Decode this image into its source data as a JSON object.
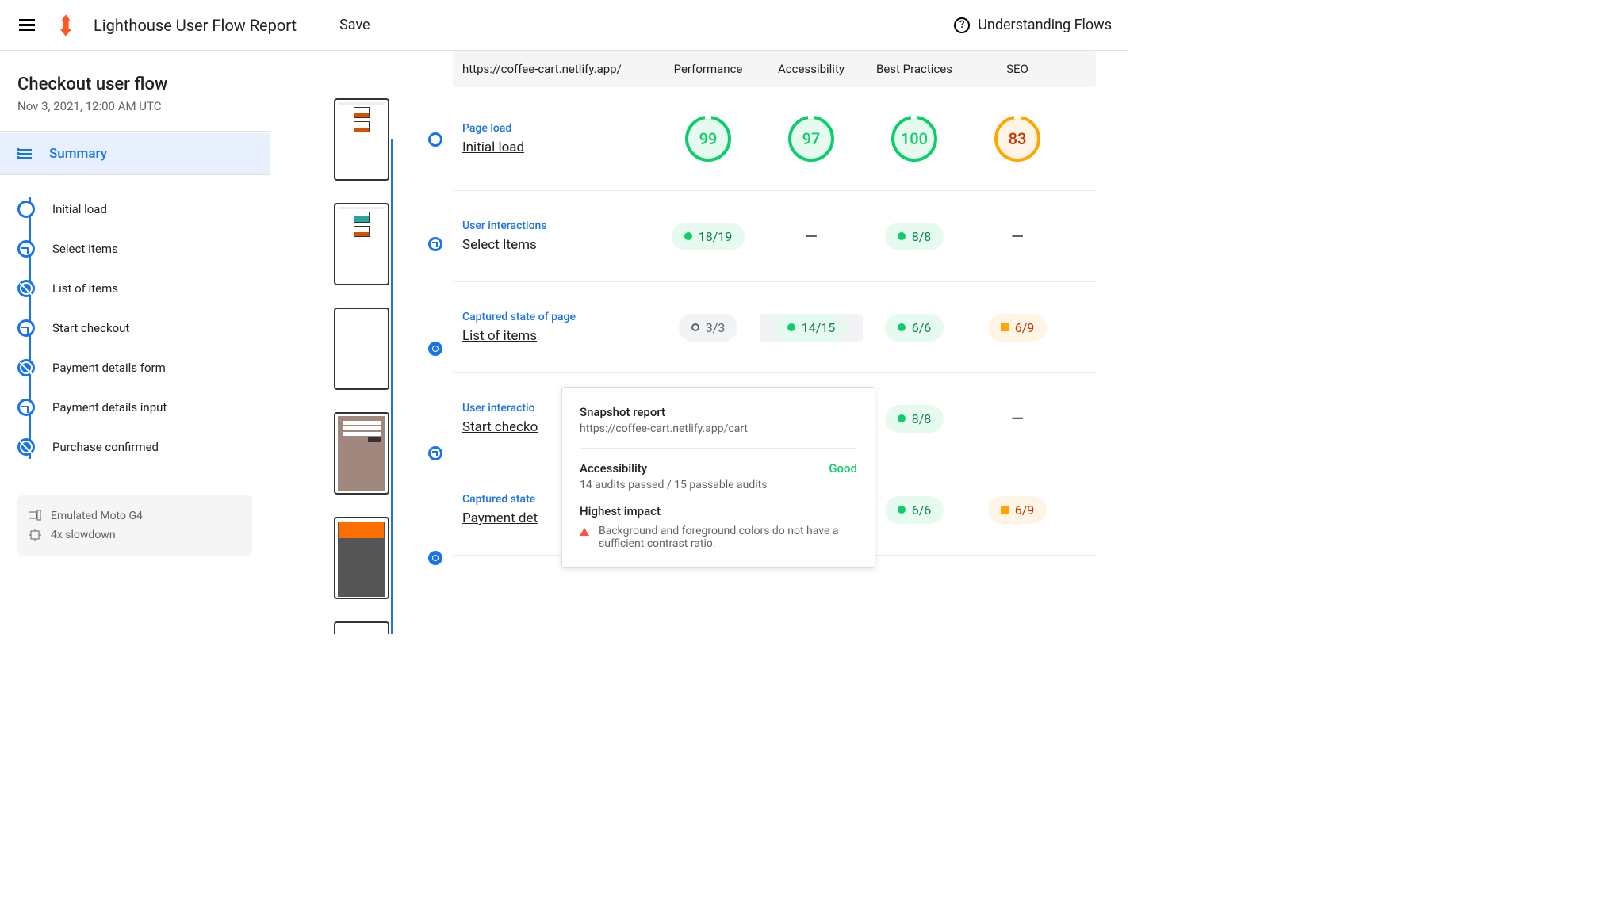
{
  "header": {
    "title": "Lighthouse User Flow Report",
    "save": "Save",
    "help": "Understanding Flows"
  },
  "sidebar": {
    "flow_title": "Checkout user flow",
    "flow_date": "Nov 3, 2021, 12:00 AM UTC",
    "summary_label": "Summary",
    "steps": [
      {
        "label": "Initial load",
        "type": "nav"
      },
      {
        "label": "Select Items",
        "type": "clock"
      },
      {
        "label": "List of items",
        "type": "snap"
      },
      {
        "label": "Start checkout",
        "type": "clock"
      },
      {
        "label": "Payment details form",
        "type": "snap"
      },
      {
        "label": "Payment details input",
        "type": "clock"
      },
      {
        "label": "Purchase confirmed",
        "type": "snap"
      }
    ],
    "env": {
      "device": "Emulated Moto G4",
      "throttle": "4x slowdown"
    }
  },
  "grid": {
    "url": "https://coffee-cart.netlify.app/",
    "categories": [
      "Performance",
      "Accessibility",
      "Best Practices",
      "SEO"
    ],
    "type_pageload": "Page load",
    "type_timespan": "User interactions",
    "type_snapshot": "Captured state of page",
    "rows": [
      {
        "name": "Initial load",
        "scores": [
          "99",
          "97",
          "100",
          "83"
        ]
      },
      {
        "name": "Select Items",
        "scores": [
          "18/19",
          "—",
          "8/8",
          "—"
        ]
      },
      {
        "name": "List of items",
        "scores": [
          "3/3",
          "14/15",
          "6/6",
          "6/9"
        ]
      },
      {
        "name": "Start checkout",
        "scores": [
          "",
          "",
          "8/8",
          "—"
        ]
      },
      {
        "name": "Payment details form",
        "scores_visible": "Payment det",
        "scores": [
          "",
          "",
          "6/6",
          "6/9"
        ]
      }
    ]
  },
  "tooltip": {
    "title": "Snapshot report",
    "url": "https://coffee-cart.netlify.app/cart",
    "category": "Accessibility",
    "rating": "Good",
    "detail": "14 audits passed / 15 passable audits",
    "impact_label": "Highest impact",
    "impact_item": "Background and foreground colors do not have a sufficient contrast ratio."
  }
}
